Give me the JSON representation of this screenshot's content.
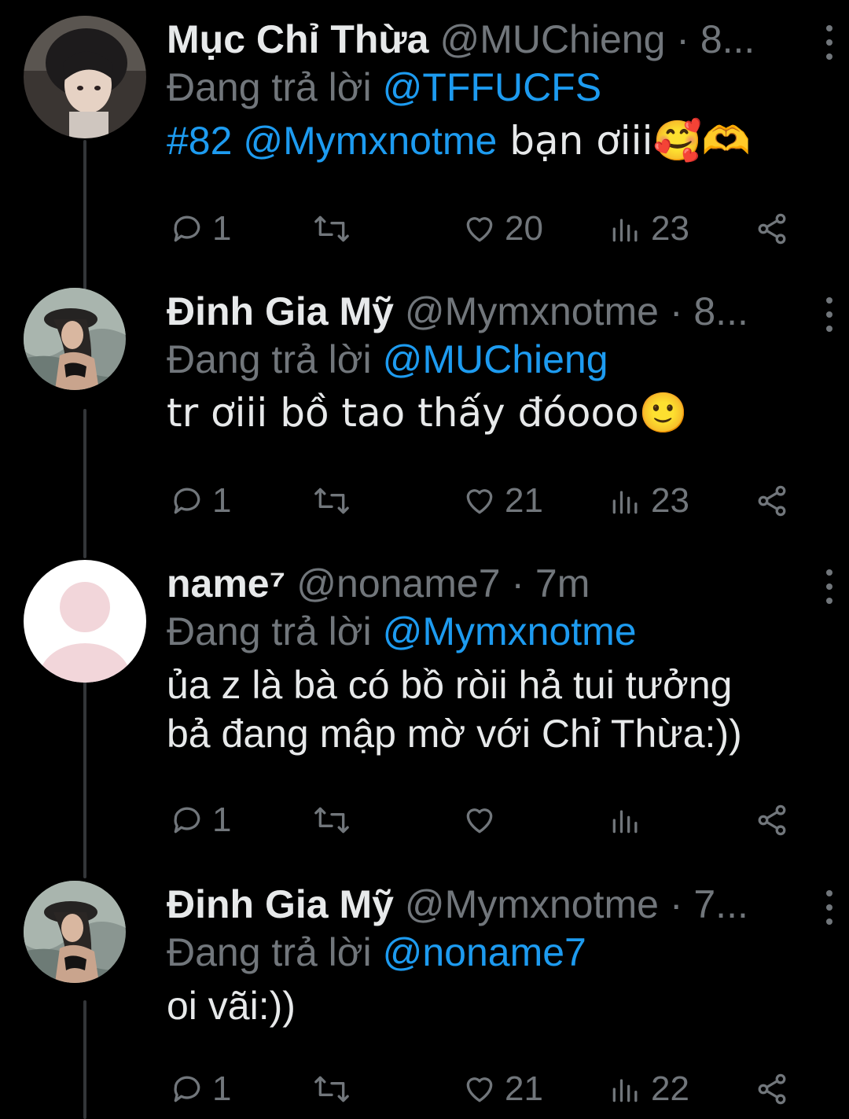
{
  "tweets": [
    {
      "name": "Mục Chỉ Thừa",
      "handle": "@MUChieng · 8...",
      "reply_prefix": "Đang trả lời",
      "reply_to": "@TFFUCFS",
      "body_lines": [
        {
          "parts": [
            {
              "text": "#82 @Mymxnotme",
              "link": true
            },
            {
              "text": " bạn ơiii🥰🫶",
              "link": false
            }
          ]
        }
      ],
      "replies": "1",
      "retweets": "",
      "likes": "20",
      "views": "23"
    },
    {
      "name": "Đinh Gia Mỹ",
      "handle": "@Mymxnotme · 8...",
      "reply_prefix": "Đang trả lời",
      "reply_to": "@MUChieng",
      "body_lines": [
        {
          "parts": [
            {
              "text": "tr ơiii bồ tao thấy đóooo🙂",
              "link": false
            }
          ]
        }
      ],
      "replies": "1",
      "retweets": "",
      "likes": "21",
      "views": "23"
    },
    {
      "name": "name⁷",
      "handle": "@noname7 · 7m",
      "reply_prefix": "Đang trả lời",
      "reply_to": "@Mymxnotme",
      "body_lines": [
        {
          "parts": [
            {
              "text": "ủa z là bà có bồ ròii hả tui tưởng",
              "link": false
            }
          ]
        },
        {
          "parts": [
            {
              "text": "bả đang mập mờ với Chỉ Thừa:))",
              "link": false
            }
          ]
        }
      ],
      "replies": "1",
      "retweets": "",
      "likes": "",
      "views": ""
    },
    {
      "name": "Đinh Gia Mỹ",
      "handle": "@Mymxnotme · 7...",
      "reply_prefix": "Đang trả lời",
      "reply_to": "@noname7",
      "body_lines": [
        {
          "parts": [
            {
              "text": "oi vãi:))",
              "link": false
            }
          ]
        }
      ],
      "replies": "1",
      "retweets": "",
      "likes": "21",
      "views": "22"
    }
  ],
  "colors": {
    "background": "#000000",
    "text": "#e7e9ea",
    "muted": "#71767b",
    "link": "#1d9bf0",
    "thread_line": "#333639"
  }
}
